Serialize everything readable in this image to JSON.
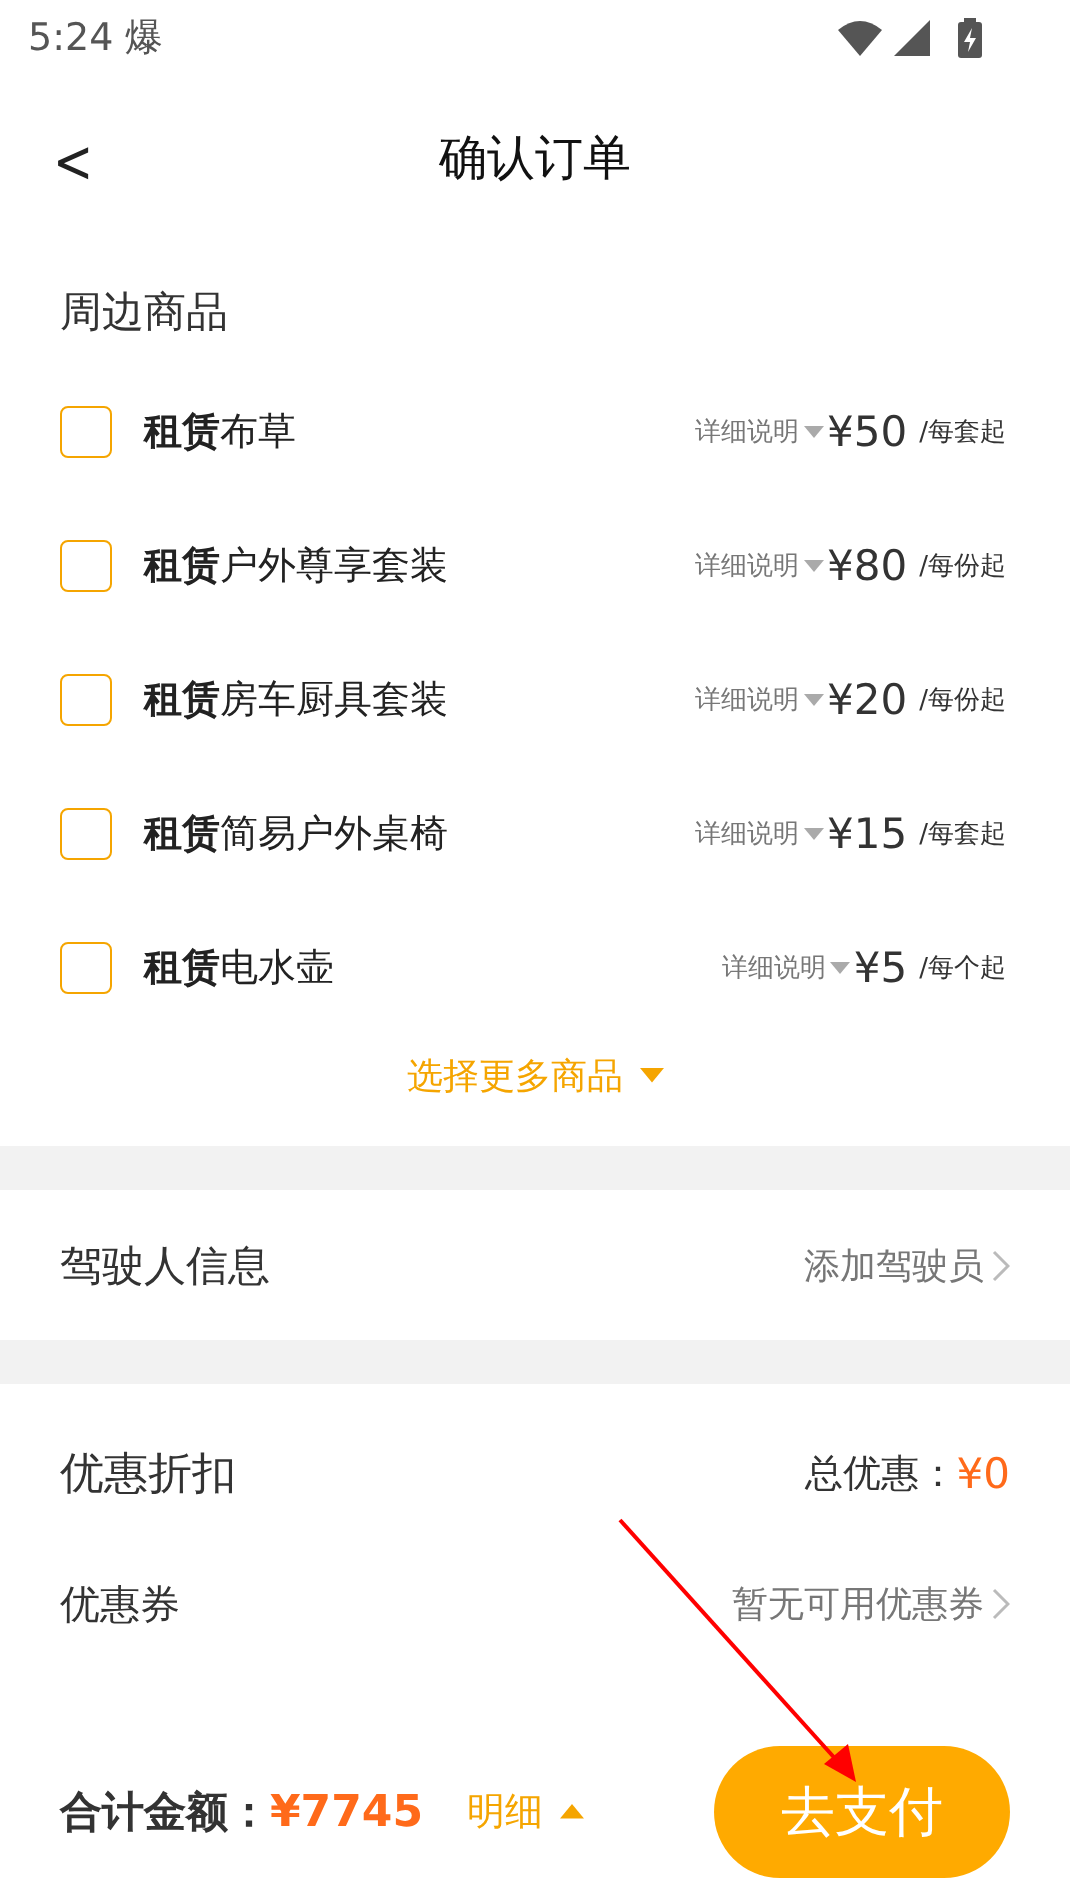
{
  "status_bar": {
    "time": "5:24",
    "notification": "爆"
  },
  "header": {
    "back": "<",
    "title": "确认订单"
  },
  "products": {
    "title": "周边商品",
    "items": [
      {
        "name": "**租赁**布草",
        "checked": false,
        "details": "详细说明",
        "price": "¥50",
        "unit": "/每套起"
      },
      {
        "name": "**租赁**户外尊享套装",
        "checked": false,
        "details": "详细说明",
        "price": "¥80",
        "unit": "/每份起"
      },
      {
        "name": "**租赁**房车厨具套装",
        "checked": false,
        "details": "详细说明",
        "price": "¥20",
        "unit": "/每份起"
      },
      {
        "name": "**租赁**简易户外桌椅",
        "checked": false,
        "details": "详细说明",
        "price": "¥15",
        "unit": "/每套起"
      },
      {
        "name": "**租赁**电水壶",
        "checked": false,
        "details": "详细说明",
        "price": "¥5",
        "unit": "/每个起"
      }
    ],
    "more": "选择更多商品"
  },
  "driver": {
    "label": "驾驶人信息",
    "action": "添加驾驶员"
  },
  "discount": {
    "title": "优惠折扣",
    "total_label": "总优惠：",
    "total_value": "¥0",
    "coupon_label": "优惠券",
    "coupon_value": "暂无可用优惠券"
  },
  "footer": {
    "total_label": "合计金额：",
    "total_value": "¥7745",
    "details": "明细",
    "pay": "去支付"
  }
}
